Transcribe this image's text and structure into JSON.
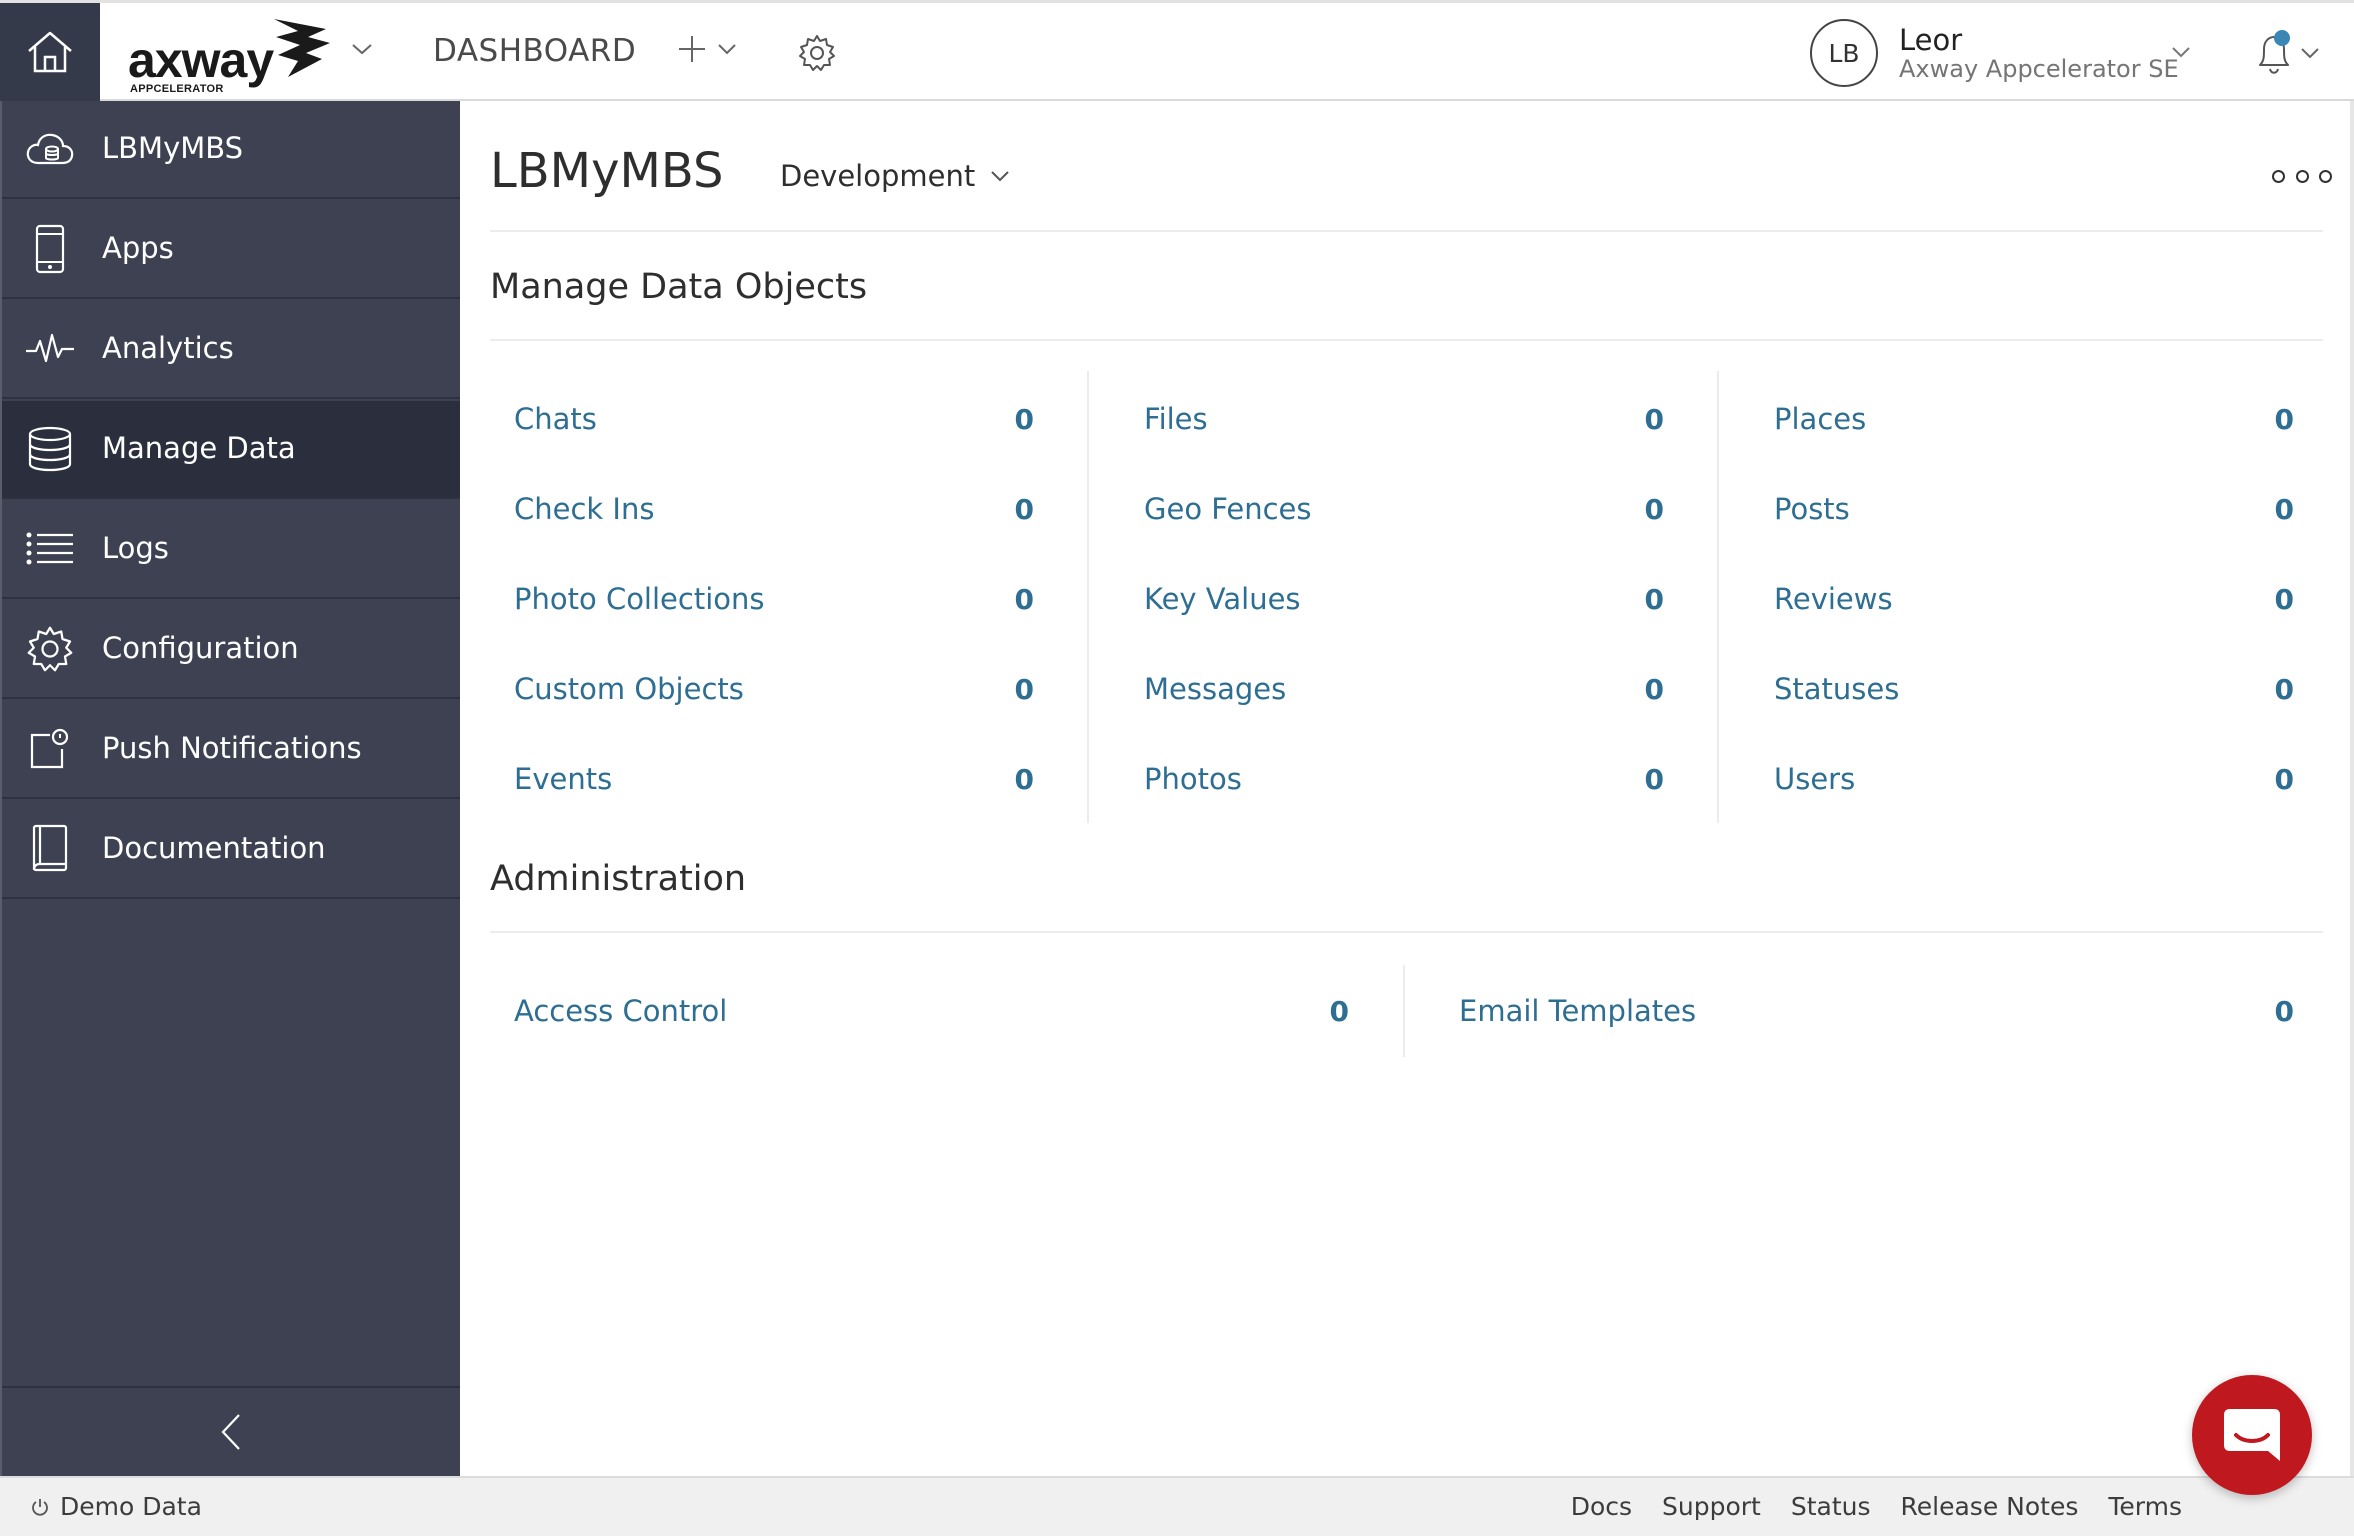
{
  "header": {
    "logo_text": "axway",
    "logo_subtext": "APPCELERATOR",
    "nav_dashboard": "DASHBOARD",
    "user": {
      "initials": "LB",
      "name": "Leor",
      "org": "Axway Appcelerator SE"
    },
    "notification_dot_color": "#3a86b5"
  },
  "sidebar": {
    "items": [
      {
        "label": "LBMyMBS",
        "icon": "cloud-database-icon",
        "active": false
      },
      {
        "label": "Apps",
        "icon": "mobile-device-icon",
        "active": false
      },
      {
        "label": "Analytics",
        "icon": "pulse-icon",
        "active": false
      },
      {
        "label": "Manage Data",
        "icon": "database-icon",
        "active": true
      },
      {
        "label": "Logs",
        "icon": "list-icon",
        "active": false
      },
      {
        "label": "Configuration",
        "icon": "gear-icon",
        "active": false
      },
      {
        "label": "Push Notifications",
        "icon": "push-notification-icon",
        "active": false
      },
      {
        "label": "Documentation",
        "icon": "book-icon",
        "active": false
      }
    ]
  },
  "main": {
    "app_title": "LBMyMBS",
    "environment": "Development",
    "sections": {
      "data_objects": {
        "title": "Manage Data Objects",
        "columns": [
          [
            {
              "label": "Chats",
              "count": "0"
            },
            {
              "label": "Check Ins",
              "count": "0"
            },
            {
              "label": "Photo Collections",
              "count": "0"
            },
            {
              "label": "Custom Objects",
              "count": "0"
            },
            {
              "label": "Events",
              "count": "0"
            }
          ],
          [
            {
              "label": "Files",
              "count": "0"
            },
            {
              "label": "Geo Fences",
              "count": "0"
            },
            {
              "label": "Key Values",
              "count": "0"
            },
            {
              "label": "Messages",
              "count": "0"
            },
            {
              "label": "Photos",
              "count": "0"
            }
          ],
          [
            {
              "label": "Places",
              "count": "0"
            },
            {
              "label": "Posts",
              "count": "0"
            },
            {
              "label": "Reviews",
              "count": "0"
            },
            {
              "label": "Statuses",
              "count": "0"
            },
            {
              "label": "Users",
              "count": "0"
            }
          ]
        ]
      },
      "administration": {
        "title": "Administration",
        "columns": [
          [
            {
              "label": "Access Control",
              "count": "0"
            }
          ],
          [
            {
              "label": "Email Templates",
              "count": "0"
            }
          ]
        ]
      }
    }
  },
  "footer": {
    "demo_label": "Demo Data",
    "links": [
      "Docs",
      "Support",
      "Status",
      "Release Notes",
      "Terms"
    ]
  },
  "colors": {
    "sidebar_bg": "#3d4152",
    "sidebar_active": "#2b2f3d",
    "link_blue": "#2e6e93",
    "chat_red": "#c0181f"
  }
}
